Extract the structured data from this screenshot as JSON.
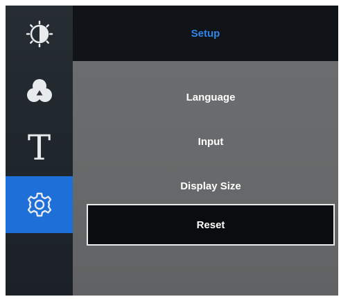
{
  "header": {
    "title": "Setup"
  },
  "sidebar": {
    "items": [
      {
        "icon": "brightness-icon",
        "active": false
      },
      {
        "icon": "color-icon",
        "active": false
      },
      {
        "icon": "text-icon",
        "glyph": "T",
        "active": false
      },
      {
        "icon": "gear-icon",
        "active": true
      }
    ]
  },
  "menu": {
    "items": [
      {
        "label": "Language",
        "selected": false
      },
      {
        "label": "Input",
        "selected": false
      },
      {
        "label": "Display Size",
        "selected": false
      },
      {
        "label": "Reset",
        "selected": true
      }
    ]
  },
  "colors": {
    "accent": "#1f6fd8",
    "title": "#2f86ea",
    "panel": "#67696a",
    "selected_bg": "#0b0c0d"
  }
}
